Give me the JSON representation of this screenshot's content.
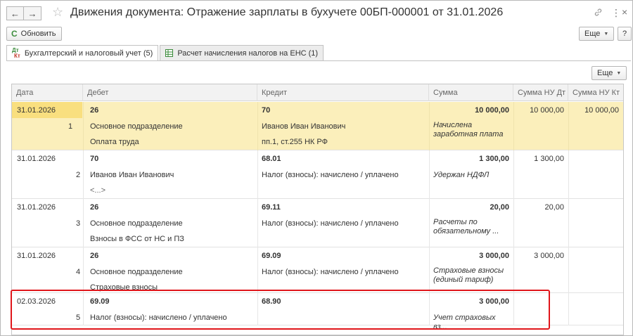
{
  "window": {
    "title": "Движения документа: Отражение зарплаты в бухучете 00БП-000001 от 31.01.2026",
    "back": "←",
    "forward": "→",
    "star": "☆",
    "link": "🔗",
    "more": "⋮",
    "close": "×"
  },
  "toolbar": {
    "refresh_label": "Обновить",
    "refresh_icon": "C",
    "more_label": "Еще",
    "help_label": "?"
  },
  "tabs": [
    {
      "label": "Бухгалтерский и налоговый учет (5)",
      "icon": "dt-kt-icon",
      "active": true
    },
    {
      "label": "Расчет начисления налогов на ЕНС (1)",
      "icon": "table-icon",
      "active": false
    }
  ],
  "panel": {
    "more_label": "Еще"
  },
  "table": {
    "columns": [
      "Дата",
      "Дебет",
      "Кредит",
      "Сумма",
      "Сумма НУ Дт",
      "Сумма НУ Кт"
    ],
    "rows": [
      {
        "date": "31.01.2026",
        "num": "1",
        "debit": [
          "26",
          "Основное подразделение",
          "Оплата труда"
        ],
        "credit": [
          "70",
          "Иванов Иван Иванович",
          "пп.1, ст.255 НК РФ"
        ],
        "sum": "10 000,00",
        "content": "Начислена заработная плата",
        "nu_dt": "10 000,00",
        "nu_kt": "10 000,00"
      },
      {
        "date": "31.01.2026",
        "num": "2",
        "debit": [
          "70",
          "Иванов Иван Иванович",
          "<...>"
        ],
        "credit": [
          "68.01",
          "Налог (взносы): начислено / уплачено",
          ""
        ],
        "sum": "1 300,00",
        "content": "Удержан НДФЛ",
        "nu_dt": "1 300,00",
        "nu_kt": ""
      },
      {
        "date": "31.01.2026",
        "num": "3",
        "debit": [
          "26",
          "Основное подразделение",
          "Взносы в ФСС от НС и ПЗ"
        ],
        "credit": [
          "69.11",
          "Налог (взносы): начислено / уплачено",
          ""
        ],
        "sum": "20,00",
        "content": "Расчеты по обязательному ...",
        "nu_dt": "20,00",
        "nu_kt": ""
      },
      {
        "date": "31.01.2026",
        "num": "4",
        "debit": [
          "26",
          "Основное подразделение",
          "Страховые взносы"
        ],
        "credit": [
          "69.09",
          "Налог (взносы): начислено / уплачено",
          ""
        ],
        "sum": "3 000,00",
        "content": "Страховые взносы (единый тариф)",
        "nu_dt": "3 000,00",
        "nu_kt": ""
      },
      {
        "date": "02.03.2026",
        "num": "5",
        "debit": [
          "69.09",
          "Налог (взносы): начислено / уплачено",
          ""
        ],
        "credit": [
          "68.90",
          "",
          ""
        ],
        "sum": "3 000,00",
        "content": "Учет страховых вз...",
        "nu_dt": "",
        "nu_kt": ""
      }
    ]
  },
  "colors": {
    "selected_row": "#fbefbb",
    "selected_cell": "#f9df7f",
    "highlight_frame": "#e0161b"
  }
}
